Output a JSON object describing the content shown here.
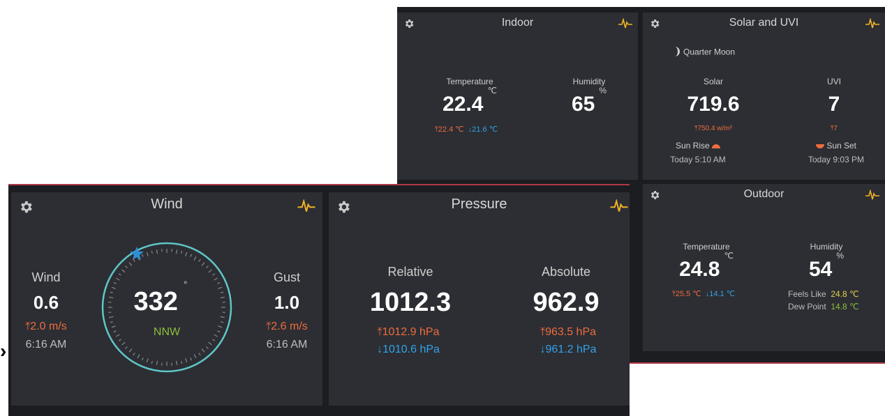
{
  "indoor": {
    "title": "Indoor",
    "temperature_label": "Temperature",
    "temperature_value": "22.4",
    "temperature_unit": "℃",
    "temperature_high": "22.4 ℃",
    "temperature_low": "21.6 ℃",
    "humidity_label": "Humidity",
    "humidity_value": "65",
    "humidity_unit": "%"
  },
  "solar_uvi": {
    "title": "Solar and UVI",
    "moon_phase": "Quarter Moon",
    "solar_label": "Solar",
    "solar_value": "719.6",
    "solar_high": "750.4 w/m²",
    "uvi_label": "UVI",
    "uvi_value": "7",
    "uvi_high": "7",
    "sunrise_label": "Sun Rise",
    "sunrise_time": "Today 5:10 AM",
    "sunset_label": "Sun Set",
    "sunset_time": "Today 9:03 PM"
  },
  "outdoor": {
    "title": "Outdoor",
    "temperature_label": "Temperature",
    "temperature_value": "24.8",
    "temperature_unit": "℃",
    "temperature_high": "25.5 ℃",
    "temperature_low": "14.1 ℃",
    "humidity_label": "Humidity",
    "humidity_value": "54",
    "humidity_unit": "%",
    "feels_like_label": "Feels Like",
    "feels_like_value": "24.8 ℃",
    "dew_point_label": "Dew Point",
    "dew_point_value": "14.8 ℃"
  },
  "wind": {
    "title": "Wind",
    "wind_label": "Wind",
    "wind_value": "0.6",
    "wind_max": "2.0 m/s",
    "wind_time": "6:16 AM",
    "direction_degrees": "332",
    "direction_unit": "°",
    "direction_cardinal": "NNW",
    "gust_label": "Gust",
    "gust_value": "1.0",
    "gust_max": "2.6 m/s",
    "gust_time": "6:16 AM"
  },
  "pressure": {
    "title": "Pressure",
    "relative_label": "Relative",
    "relative_value": "1012.3",
    "relative_high": "1012.9 hPa",
    "relative_low": "1010.6 hPa",
    "absolute_label": "Absolute",
    "absolute_value": "962.9",
    "absolute_high": "963.5 hPa",
    "absolute_low": "961.2 hPa"
  },
  "icons": {
    "settings": "gear-icon",
    "chart": "pulse-chart-icon",
    "max": "arrow-up-to-line",
    "min": "arrow-down"
  },
  "colors": {
    "panel_bg": "#2c2e33",
    "frame_bg": "#1c1d20",
    "max_color": "#ef6c3d",
    "min_color": "#33a2ea",
    "accent_yellow": "#f0b323",
    "compass_ring": "#5fc5c7",
    "cardinal_green": "#8cbd3b"
  }
}
